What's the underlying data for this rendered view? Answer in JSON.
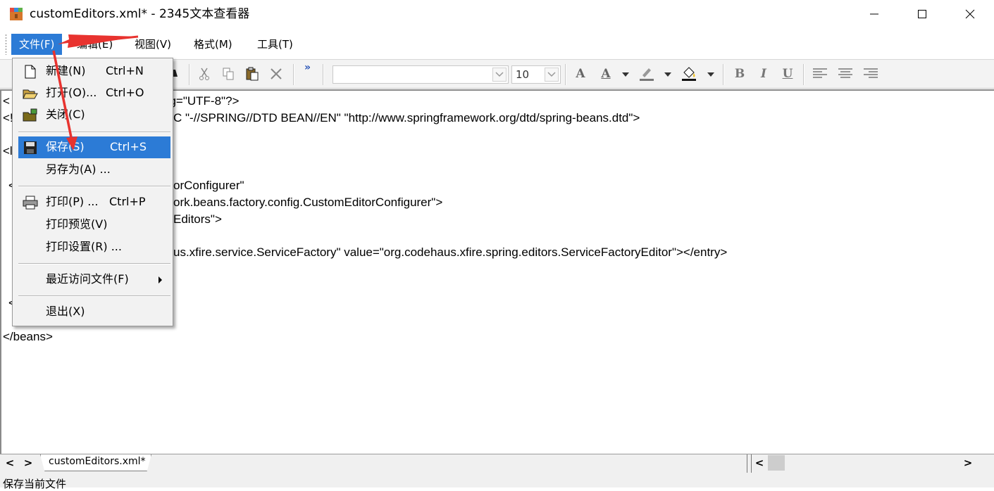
{
  "window": {
    "title": "customEditors.xml* - 2345文本查看器"
  },
  "menubar": {
    "items": [
      {
        "label": "文件(F)"
      },
      {
        "label": "编辑(E)"
      },
      {
        "label": "视图(V)"
      },
      {
        "label": "格式(M)"
      },
      {
        "label": "工具(T)"
      }
    ]
  },
  "toolbar": {
    "font_name": "",
    "font_size": "10",
    "chevron": "»",
    "bold": "B",
    "italic": "I",
    "underline": "U",
    "font_color_glyph": "A",
    "grow_font_glyph": "A"
  },
  "editor": {
    "lines": [
      "<",
      "<!",
      "<l",
      "<",
      "<",
      "</beans>"
    ],
    "fragments": [
      "ng=\"UTF-8\"?>",
      "C \"-//SPRING//DTD BEAN//EN\" \"http://www.springframework.org/dtd/spring-beans.dtd\">",
      "orConfigurer\"",
      "ork.beans.factory.config.CustomEditorConfigurer\">",
      "Editors\">",
      "us.xfire.service.ServiceFactory\" value=\"org.codehaus.xfire.spring.editors.ServiceFactoryEditor\"></entry>"
    ]
  },
  "file_menu": {
    "items": [
      {
        "label": "新建(N)",
        "shortcut": "Ctrl+N",
        "icon": "new-file-icon"
      },
      {
        "label": "打开(O)...",
        "shortcut": "Ctrl+O",
        "icon": "open-folder-icon"
      },
      {
        "label": "关闭(C)",
        "shortcut": "",
        "icon": "close-folder-icon"
      },
      {
        "label": "保存(S)",
        "shortcut": "Ctrl+S",
        "icon": "save-disk-icon"
      },
      {
        "label": "另存为(A) ...",
        "shortcut": "",
        "icon": ""
      },
      {
        "label": "打印(P) ...",
        "shortcut": "Ctrl+P",
        "icon": "printer-icon"
      },
      {
        "label": "打印预览(V)",
        "shortcut": "",
        "icon": ""
      },
      {
        "label": "打印设置(R) ...",
        "shortcut": "",
        "icon": ""
      },
      {
        "label": "最近访问文件(F)",
        "shortcut": "",
        "icon": ""
      },
      {
        "label": "退出(X)",
        "shortcut": "",
        "icon": ""
      }
    ]
  },
  "tabs": {
    "prev": "<",
    "next": ">",
    "file_tab": "customEditors.xml*"
  },
  "hscroll": {
    "left": "<",
    "right": ">"
  },
  "status": {
    "text": "保存当前文件"
  },
  "colors": {
    "highlight": "#2c7bd6",
    "annotation": "#e8332f"
  }
}
